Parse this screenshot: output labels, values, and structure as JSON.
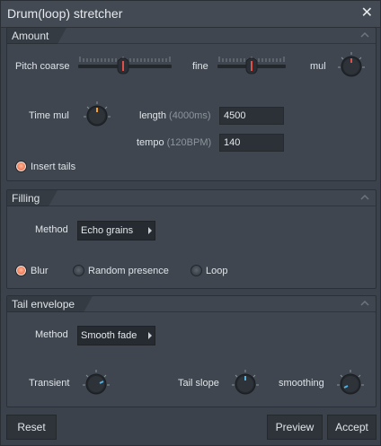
{
  "window": {
    "title": "Drum(loop) stretcher",
    "close_icon": "close-icon"
  },
  "amount": {
    "tab": "Amount",
    "pitch_coarse_label": "Pitch coarse",
    "fine_label": "fine",
    "mul_label": "mul",
    "time_mul_label": "Time mul",
    "length_label": "length",
    "length_hint": "(4000ms)",
    "length_value": "4500",
    "tempo_label": "tempo",
    "tempo_hint": "(120BPM)",
    "tempo_value": "140",
    "insert_tails_label": "Insert tails"
  },
  "filling": {
    "tab": "Filling",
    "method_label": "Method",
    "method_value": "Echo grains",
    "blur_label": "Blur",
    "random_presence_label": "Random presence",
    "loop_label": "Loop"
  },
  "tail_envelope": {
    "tab": "Tail envelope",
    "method_label": "Method",
    "method_value": "Smooth fade",
    "transient_label": "Transient",
    "tail_slope_label": "Tail slope",
    "smoothing_label": "smoothing"
  },
  "footer": {
    "reset_label": "Reset",
    "preview_label": "Preview",
    "accept_label": "Accept"
  },
  "colors": {
    "accent_red": "#e0504a",
    "accent_orange": "#f3a12f",
    "accent_blue": "#4fb3e6",
    "radio_on": "#f07a52"
  }
}
